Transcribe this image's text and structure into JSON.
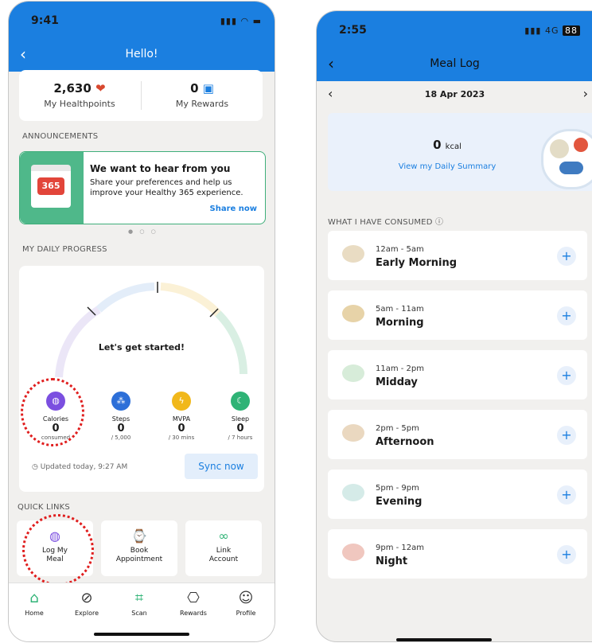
{
  "left": {
    "status_time": "9:41",
    "status_icons": "▮▮▮ ◠ ▬",
    "title": "Hello!",
    "healthpoints_value": "2,630",
    "healthpoints_label": "My Healthpoints",
    "rewards_value": "0",
    "rewards_label": "My Rewards",
    "announcements_title": "ANNOUNCEMENTS",
    "announcement_badge": "365",
    "announcement_heading": "We want to hear from you",
    "announcement_body": "Share your preferences and help us improve your Healthy 365 experience.",
    "announcement_link": "Share now",
    "daily_progress_title": "MY DAILY PROGRESS",
    "gauge_text": "Let's get started!",
    "metrics": [
      {
        "label": "Calories",
        "value": "0",
        "sub": "consumed"
      },
      {
        "label": "Steps",
        "value": "0",
        "sub": "/ 5,000"
      },
      {
        "label": "MVPA",
        "value": "0",
        "sub": "/ 30 mins"
      },
      {
        "label": "Sleep",
        "value": "0",
        "sub": "/ 7 hours"
      }
    ],
    "updated_text": "Updated today, 9:27 AM",
    "sync_label": "Sync now",
    "quick_links_title": "QUICK LINKS",
    "quick_links": [
      {
        "label": "Log My Meal"
      },
      {
        "label": "Book Appointment"
      },
      {
        "label": "Link Account"
      }
    ],
    "nav": [
      {
        "label": "Home"
      },
      {
        "label": "Explore"
      },
      {
        "label": "Scan"
      },
      {
        "label": "Rewards"
      },
      {
        "label": "Profile"
      }
    ],
    "colors": {
      "primary": "#1b7fe0",
      "calories": "#7b4fe0",
      "steps": "#2d6fd8",
      "mvpa": "#f1b81b",
      "sleep": "#2fb376",
      "highlight": "#e01e1e"
    }
  },
  "right": {
    "status_time": "2:55",
    "status_network": "4G",
    "status_battery": "88",
    "title": "Meal Log",
    "date": "18 Apr 2023",
    "kcal_value": "0",
    "kcal_unit": "kcal",
    "summary_link": "View my Daily Summary",
    "consumed_title": "WHAT I HAVE CONSUMED ⓘ",
    "meals": [
      {
        "time": "12am - 5am",
        "name": "Early Morning"
      },
      {
        "time": "5am - 11am",
        "name": "Morning"
      },
      {
        "time": "11am - 2pm",
        "name": "Midday"
      },
      {
        "time": "2pm - 5pm",
        "name": "Afternoon"
      },
      {
        "time": "5pm - 9pm",
        "name": "Evening"
      },
      {
        "time": "9pm - 12am",
        "name": "Night"
      }
    ]
  }
}
